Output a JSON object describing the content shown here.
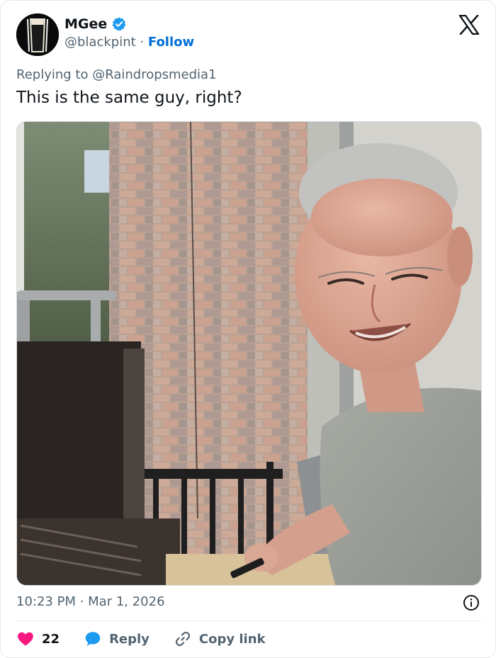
{
  "author": {
    "display_name": "MGee",
    "handle": "@blackpint",
    "separator": "·",
    "follow_label": "Follow"
  },
  "tweet": {
    "reply_prefix": "Replying to",
    "reply_handle": "@Raindropsmedia1",
    "text": "This is the same guy, right?",
    "timestamp": "10:23 PM · Mar 1, 2026"
  },
  "actions": {
    "like_count": "22",
    "reply_label": "Reply",
    "copy_link_label": "Copy link"
  },
  "colors": {
    "brand_blue": "#1d9bf0",
    "follow_blue": "#006fd6",
    "like_pink": "#f91880",
    "muted_text": "#536471"
  },
  "icons": {
    "verified": "verified-badge-icon",
    "platform": "x-logo-icon",
    "like": "heart-icon",
    "reply": "speech-bubble-icon",
    "copy": "link-icon",
    "info": "info-icon"
  }
}
